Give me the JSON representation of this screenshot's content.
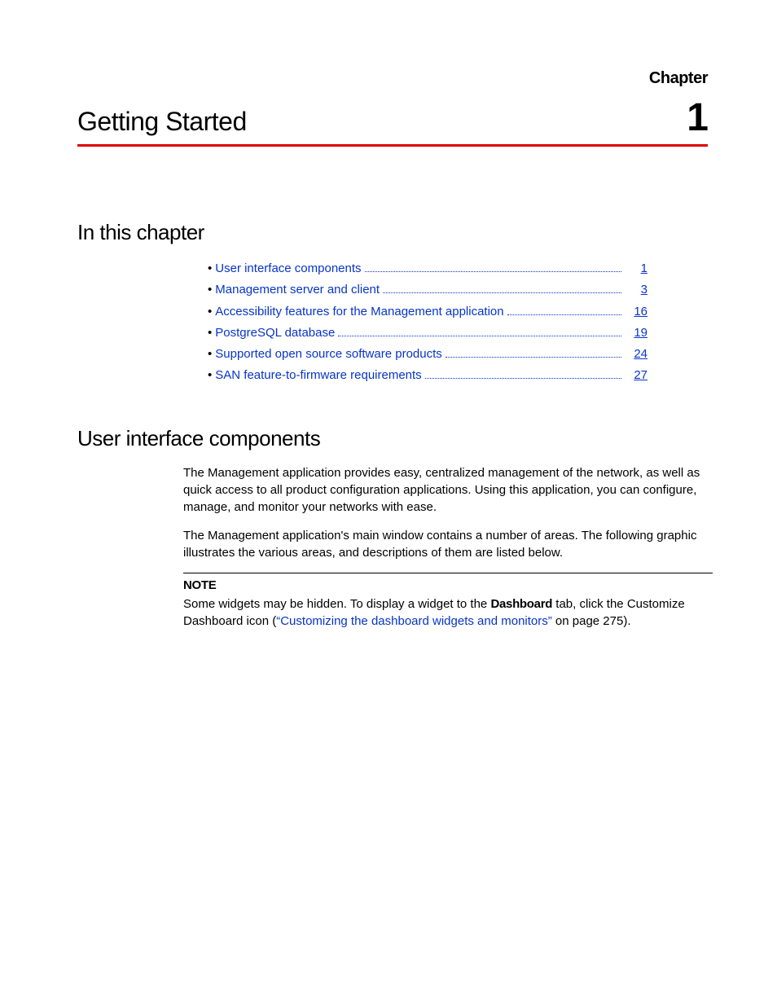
{
  "header": {
    "chapter_label": "Chapter",
    "chapter_title": "Getting Started",
    "chapter_number": "1"
  },
  "sections": {
    "toc_heading": "In this chapter",
    "body_heading": "User interface components"
  },
  "toc": [
    {
      "label": "User interface components",
      "page": "1"
    },
    {
      "label": "Management server and client",
      "page": "3"
    },
    {
      "label": "Accessibility features for the Management application",
      "page": "16"
    },
    {
      "label": "PostgreSQL database",
      "page": "19"
    },
    {
      "label": "Supported open source software products",
      "page": "24"
    },
    {
      "label": "SAN feature-to-firmware requirements",
      "page": "27"
    }
  ],
  "body": {
    "p1": "The Management application provides easy, centralized management of the network, as well as quick access to all product configuration applications. Using this application, you can configure, manage, and monitor your networks with ease.",
    "p2": "The Management application's main window contains a number of areas. The following graphic illustrates the various areas, and descriptions of them are listed below."
  },
  "note": {
    "label": "NOTE",
    "pre": "Some widgets may be hidden. To display a widget to the ",
    "bold": "Dashboard",
    "mid": " tab, click the Customize Dashboard icon (",
    "xref": "“Customizing the dashboard widgets and monitors”",
    "post": " on page 275)."
  }
}
